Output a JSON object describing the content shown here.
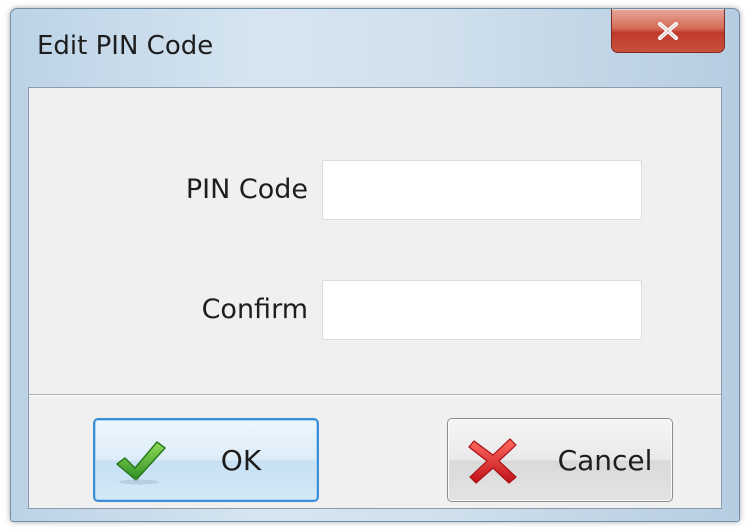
{
  "window": {
    "title": "Edit PIN Code",
    "close_icon": "close-icon"
  },
  "form": {
    "pin_label": "PIN Code",
    "pin_value": "",
    "confirm_label": "Confirm",
    "confirm_value": ""
  },
  "buttons": {
    "ok_label": "OK",
    "ok_icon": "checkmark-icon",
    "cancel_label": "Cancel",
    "cancel_icon": "red-x-icon"
  },
  "colors": {
    "close_button": "#c9513c",
    "ok_border": "#3c8fd6",
    "check_green": "#3fa830",
    "cancel_red": "#d8262a"
  }
}
